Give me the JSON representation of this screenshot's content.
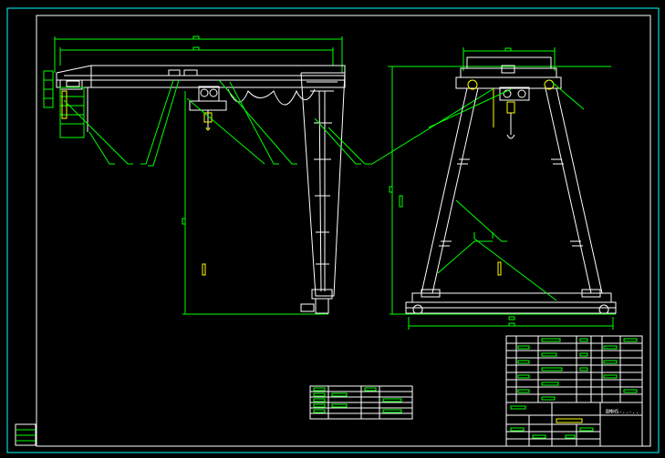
{
  "drawing": {
    "title_block_code": "BMH5-..-.."
  },
  "colors": {
    "background": "#000000",
    "frame": "#00ffff",
    "geometry": "#ffffff",
    "dimension": "#00ff00",
    "text": "#ffff00"
  }
}
